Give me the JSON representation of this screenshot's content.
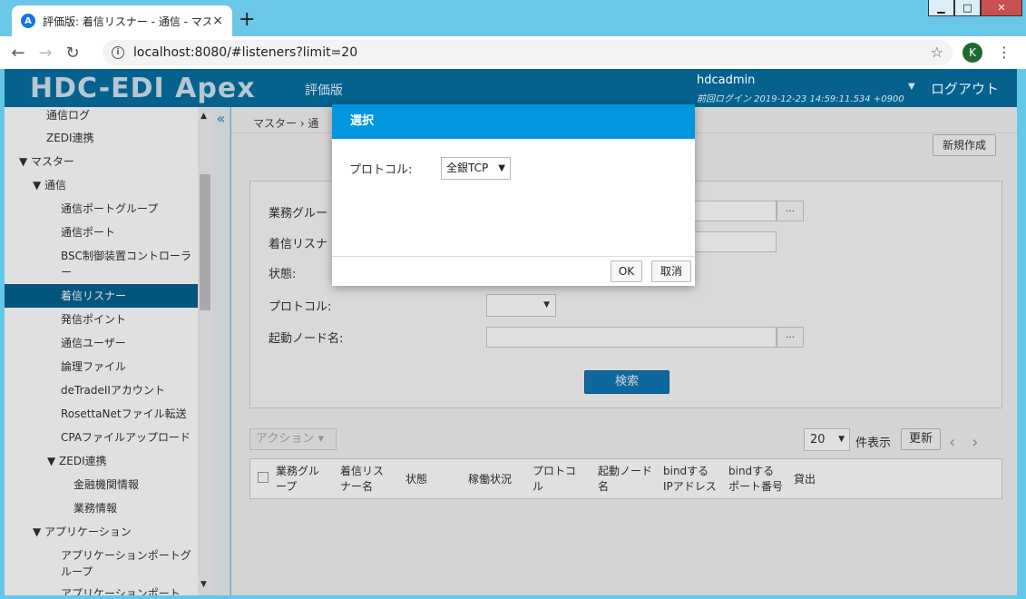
{
  "browser": {
    "tab_title": "評価版: 着信リスナー - 通信 - マス",
    "tab_close": "×",
    "new_tab": "+",
    "favicon": "A",
    "url": "localhost:8080/#listeners?limit=20",
    "profile_initial": "K",
    "window_buttons": {
      "minimize": "▁",
      "maximize": "□",
      "close": "✕"
    }
  },
  "header": {
    "logo": "HDC-EDI Apex",
    "trial": "評価版",
    "user": "hdcadmin",
    "last_login": "前回ログイン 2019-12-23 14:59:11.534 +0900",
    "logout": "ログアウト"
  },
  "sidebar": {
    "collapse_icon": "«",
    "items": [
      {
        "label": "通信ログ"
      },
      {
        "label": "ZEDI連携"
      },
      {
        "label": "▼ マスター"
      },
      {
        "label": "▼ 通信"
      },
      {
        "label": "通信ポートグループ"
      },
      {
        "label": "通信ポート"
      },
      {
        "label": "BSC制御装置コントローラ"
      },
      {
        "label": "ー"
      },
      {
        "label": "着信リスナー"
      },
      {
        "label": "発信ポイント"
      },
      {
        "label": "通信ユーザー"
      },
      {
        "label": "論理ファイル"
      },
      {
        "label": "deTradeIIアカウント"
      },
      {
        "label": "RosettaNetファイル転送"
      },
      {
        "label": "CPAファイルアップロード"
      },
      {
        "label": "▼ ZEDI連携"
      },
      {
        "label": "金融機関情報"
      },
      {
        "label": "業務情報"
      },
      {
        "label": "▼ アプリケーション"
      },
      {
        "label": "アプリケーションポートグ"
      },
      {
        "label": "ループ"
      },
      {
        "label": "アプリケーションポート"
      }
    ]
  },
  "main": {
    "breadcrumb": "マスター  ›  通",
    "new_button": "新規作成",
    "form": {
      "business_group": "業務グルー",
      "listener_name": "着信リスナ",
      "status": "状態:",
      "protocol": "プロトコル:",
      "node_name": "起動ノード名:",
      "dots": "…",
      "search_button": "検索"
    },
    "action_button": "アクション ▾",
    "page_size": "20",
    "page_size_label": "件表示",
    "refresh_button": "更新",
    "pager_prev": "‹",
    "pager_next": "›",
    "columns": [
      "業務グル\nープ",
      "着信リス\nナー名",
      "状態",
      "稼働状況",
      "プロトコ\nル",
      "起動ノード\n名",
      "bindする\nIPアドレス",
      "bindする\nポート番号",
      "貸出"
    ]
  },
  "modal": {
    "title": "選択",
    "protocol_label": "プロトコル:",
    "protocol_value": "全銀TCP",
    "ok": "OK",
    "cancel": "取消"
  }
}
